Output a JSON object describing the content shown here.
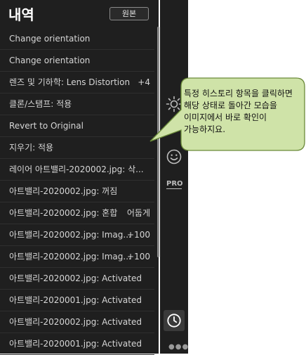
{
  "panel": {
    "title": "내역",
    "original_button": "원본"
  },
  "history": [
    {
      "label": "Change orientation",
      "value": ""
    },
    {
      "label": "Change orientation",
      "value": ""
    },
    {
      "label": "렌즈 및 기하학: Lens Distortion",
      "value": "+4"
    },
    {
      "label": "클론/스탬프: 적용",
      "value": ""
    },
    {
      "label": "Revert to Original",
      "value": ""
    },
    {
      "label": "지우기: 적용",
      "value": ""
    },
    {
      "label": "레이어 아트밸리-2020002.jpg: 삭...",
      "value": ""
    },
    {
      "label": "아트밸리-2020002.jpg: 꺼짐",
      "value": ""
    },
    {
      "label": "아트밸리-2020002.jpg: 혼합",
      "value": "어둡게"
    },
    {
      "label": "아트밸리-2020002.jpg: Imag...",
      "value": "+100"
    },
    {
      "label": "아트밸리-2020002.jpg: Imag...",
      "value": "+100"
    },
    {
      "label": "아트밸리-2020002.jpg: Activated",
      "value": ""
    },
    {
      "label": "아트밸리-2020001.jpg: Activated",
      "value": ""
    },
    {
      "label": "아트밸리-2020002.jpg: Activated",
      "value": ""
    },
    {
      "label": "아트밸리-2020001.jpg: Activated",
      "value": ""
    }
  ],
  "toolbar": {
    "pro_label": "PRO"
  },
  "callout": {
    "text": "특정 히스토리 항목을 클릭하면 해당 상태로 돌아간 모습을 이미지에서 바로 확인이 가능하지요."
  },
  "colors": {
    "panel_bg": "#1f1f1f",
    "callout_fill": "#cfe3a8",
    "callout_border": "#6b8a3a"
  }
}
